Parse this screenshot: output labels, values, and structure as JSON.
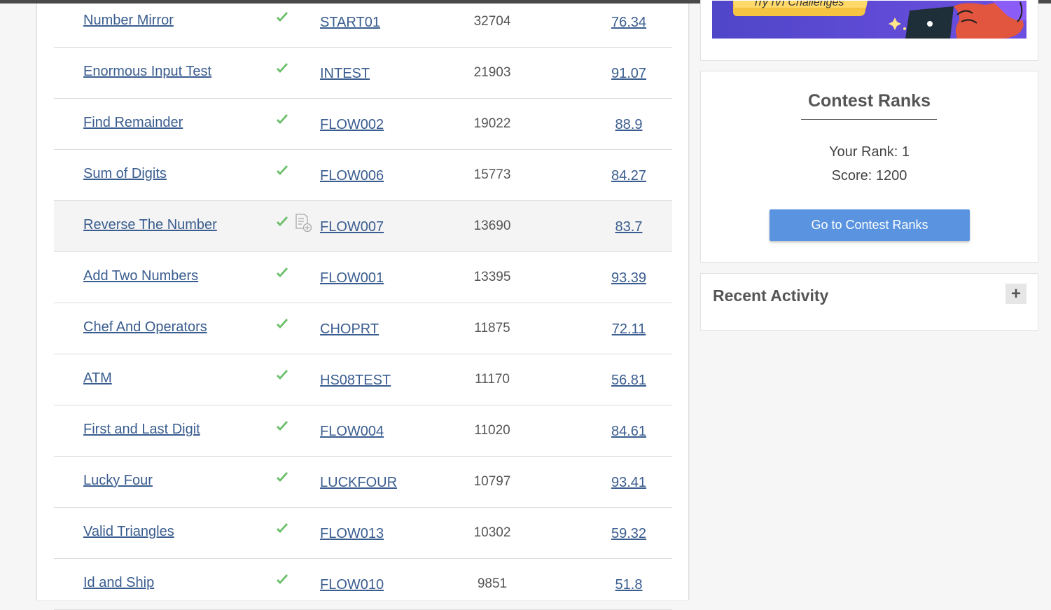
{
  "problems": [
    {
      "name": "Number Mirror",
      "code": "START01",
      "submissions": "32704",
      "accuracy": "76.34",
      "solved": true
    },
    {
      "name": "Enormous Input Test",
      "code": "INTEST",
      "submissions": "21903",
      "accuracy": "91.07",
      "solved": true
    },
    {
      "name": "Find Remainder",
      "code": "FLOW002",
      "submissions": "19022",
      "accuracy": "88.9",
      "solved": true
    },
    {
      "name": "Sum of Digits",
      "code": "FLOW006",
      "submissions": "15773",
      "accuracy": "84.27",
      "solved": true
    },
    {
      "name": "Reverse The Number",
      "code": "FLOW007",
      "submissions": "13690",
      "accuracy": "83.7",
      "solved": true,
      "hovered": true
    },
    {
      "name": "Add Two Numbers",
      "code": "FLOW001",
      "submissions": "13395",
      "accuracy": "93.39",
      "solved": true
    },
    {
      "name": "Chef And Operators",
      "code": "CHOPRT",
      "submissions": "11875",
      "accuracy": "72.11",
      "solved": true
    },
    {
      "name": "ATM",
      "code": "HS08TEST",
      "submissions": "11170",
      "accuracy": "56.81",
      "solved": true
    },
    {
      "name": "First and Last Digit",
      "code": "FLOW004",
      "submissions": "11020",
      "accuracy": "84.61",
      "solved": true
    },
    {
      "name": "Lucky Four",
      "code": "LUCKFOUR",
      "submissions": "10797",
      "accuracy": "93.41",
      "solved": true
    },
    {
      "name": "Valid Triangles",
      "code": "FLOW013",
      "submissions": "10302",
      "accuracy": "59.32",
      "solved": true
    },
    {
      "name": "Id and Ship",
      "code": "FLOW010",
      "submissions": "9851",
      "accuracy": "51.8",
      "solved": true
    }
  ],
  "banner": {
    "text": "Try IVI Challenges"
  },
  "contest_ranks": {
    "title": "Contest Ranks",
    "your_rank": "Your Rank: 1",
    "score": "Score: 1200",
    "button_label": "Go to Contest Ranks"
  },
  "recent_activity": {
    "title": "Recent Activity",
    "expand_icon": "+"
  },
  "colors": {
    "link": "#3a5d8f",
    "check": "#6abf69",
    "button": "#5a93e0"
  }
}
